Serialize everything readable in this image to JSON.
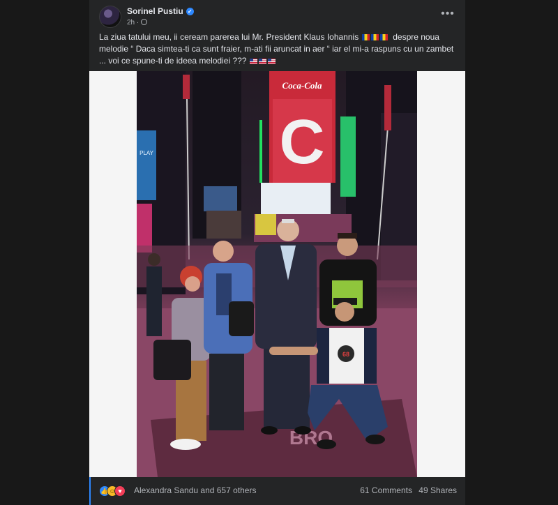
{
  "post": {
    "author": "Sorinel Pustiu",
    "timestamp": "2h",
    "text_line1": "La ziua tatului meu, ii ceream parerea lui Mr. President Klaus Iohannis",
    "text_line1b": "despre noua",
    "text_line2": "melodie “ Daca simtea-ti ca sunt fraier, m-ati fii aruncat in aer “  iar el mi-a raspuns cu un zambet",
    "text_line3": "... voi ce spune-ti de ideea melodiei ???",
    "icons": {
      "more": "more-horizontal-icon",
      "visibility": "globe-icon",
      "verified": "verified-badge-icon"
    },
    "photo": {
      "sign_brand": "Coca-Cola",
      "sign_letter": "C",
      "billboard_left": "PLAY",
      "shirt_text": "68",
      "street_text": "BRO"
    }
  },
  "footer": {
    "reactors": "Alexandra Sandu and 657 others",
    "comments": "61 Comments",
    "shares": "49 Shares"
  },
  "colors": {
    "background": "#181818",
    "card": "#242526",
    "accent": "#2d88ff",
    "text": "#e4e6eb",
    "muted": "#b0b3b8"
  }
}
